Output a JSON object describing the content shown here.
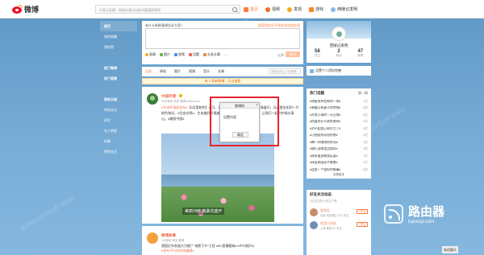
{
  "topbar": {
    "logo_text": "微博",
    "search_placeholder": "大家正在搜：四部分表达向秘书要搜索到的",
    "nav": [
      {
        "label": "首页",
        "icon": "home-icon",
        "active": true
      },
      {
        "label": "视频",
        "icon": "video-icon",
        "active": false
      },
      {
        "label": "发现",
        "icon": "discover-icon",
        "active": false
      },
      {
        "label": "游戏",
        "icon": "game-icon",
        "active": false
      },
      {
        "label": "西陵记发明",
        "icon": "user-icon",
        "active": false
      }
    ]
  },
  "leftnav": {
    "items": [
      {
        "label": "首页",
        "style": "hl"
      },
      {
        "label": "我的收藏",
        "style": ""
      },
      {
        "label": "我的赞",
        "style": ""
      },
      {
        "label": "",
        "style": ""
      },
      {
        "label": "热门微博",
        "style": "bold"
      },
      {
        "label": "热门视频",
        "style": "bold"
      },
      {
        "label": "",
        "style": ""
      },
      {
        "label": "我的分组",
        "style": "bold"
      },
      {
        "label": "特别关注",
        "style": ""
      },
      {
        "label": "同学",
        "style": ""
      },
      {
        "label": "名人明星",
        "style": ""
      },
      {
        "label": "同事",
        "style": ""
      },
      {
        "label": "悄悄关注",
        "style": ""
      }
    ]
  },
  "compose": {
    "title": "有什么新鲜事想告诉大家?",
    "hint": "国家网信办不得发布违规信息",
    "tools": [
      "表情",
      "图片",
      "视频",
      "话题",
      "头条文章",
      "···"
    ],
    "scope": "公开",
    "publish": "发布"
  },
  "tabs": {
    "items": [
      "全部",
      "原创",
      "图片",
      "视频",
      "音乐",
      "文章"
    ],
    "search_placeholder": "搜索我关注人的微博"
  },
  "newbar": {
    "text": "有 1 条新微博，点击查看"
  },
  "post1": {
    "name": "中国环境",
    "meta": "52分钟前 来自 微博 weibo.com",
    "text_prefix": "#生态环境部发布#",
    "text": "【5月是粉色】近日，内蒙古额济纳旗，湖边格桑花海盛开，远远望去如同一片粉色海洋。#生态文明#，生态美好环境越来越好，网友直呼美不胜收。让我们一起守护绿水青山。#美丽中国#",
    "photo_caption": "美丽河畔 格桑花盛开"
  },
  "dialog": {
    "title": "微博网",
    "close": "×",
    "message": "设置内容",
    "ok": "确定"
  },
  "post2": {
    "name": "微博故事",
    "meta": "1分钟前 来自 微博",
    "text": "我国近年发展大力推广“电影下乡”工程 #5G直播看病# #乡村振兴#",
    "text2": "#发布平行的时间编辑#"
  },
  "profile": {
    "name": "西陵记发明",
    "stats": [
      {
        "num": "58",
        "label": "关注"
      },
      {
        "num": "2",
        "label": "粉丝"
      },
      {
        "num": "47",
        "label": "微博"
      }
    ]
  },
  "pbox": {
    "label": "设置个人资料完善"
  },
  "hot": {
    "title": "热门话题",
    "change": "换一换",
    "items": [
      {
        "title": "#明星发布会新的一季#",
        "count": "1亿"
      },
      {
        "title": "#有趣又有意义的传统#",
        "count": "6亿"
      },
      {
        "title": "#外卖小哥的一天日常#",
        "count": "5亿"
      },
      {
        "title": "#你喜欢什么样的老师#",
        "count": "2亿"
      },
      {
        "title": "#对不起我已经尽力了#",
        "count": "8亿"
      },
      {
        "title": "#小朋友的奇思妙想#",
        "count": "4亿"
      },
      {
        "title": "#喝一杯咖啡的时间#",
        "count": "1亿"
      },
      {
        "title": "#旅行去哪里比较好#",
        "count": "3亿"
      },
      {
        "title": "#周末要去哪里玩耍#",
        "count": "7亿"
      },
      {
        "title": "#网友晒出家乡美食#",
        "count": "2亿"
      },
      {
        "title": "#这是一个很好的故事#",
        "count": "6亿"
      }
    ],
    "more": "查看更多"
  },
  "follow": {
    "title": "好友关注动态",
    "hint": "1位关注的人关注了他",
    "items": [
      {
        "name": "张先生",
        "sub": "北京 科技博主 12人关注",
        "btn": "+关注"
      },
      {
        "name": "吃货小分队",
        "sub": "上海 美食 8人关注",
        "btn": "+关注"
      }
    ]
  },
  "brand": {
    "cn": "路由器",
    "en": "luyouqi.com"
  },
  "float_btn": {
    "label": "私信聊天"
  },
  "colors": {
    "accent": "#fa7d3c",
    "alert": "#e8242e",
    "link": "#eb7350"
  }
}
